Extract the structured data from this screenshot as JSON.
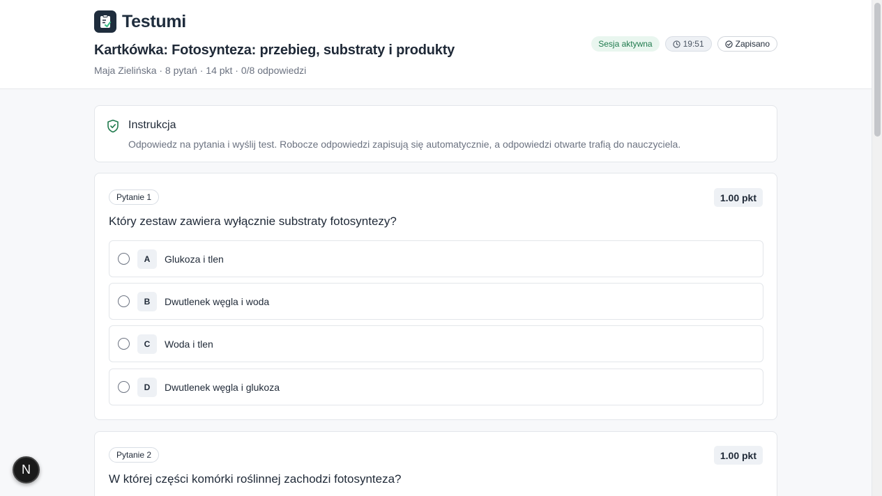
{
  "app": {
    "name": "Testumi"
  },
  "quiz": {
    "title": "Kartkówka: Fotosynteza: przebieg, substraty i produkty",
    "meta": "Maja Zielińska · 8 pytań · 14 pkt · 0/8 odpowiedzi"
  },
  "badges": {
    "session": "Sesja aktywna",
    "timer": "19:51",
    "saved": "Zapisano"
  },
  "instructions": {
    "title": "Instrukcja",
    "text": "Odpowiedz na pytania i wyślij test. Robocze odpowiedzi zapisują się automatycznie, a odpowiedzi otwarte trafią do nauczyciela."
  },
  "questions": [
    {
      "label": "Pytanie 1",
      "points": "1.00 pkt",
      "text": "Który zestaw zawiera wyłącznie substraty fotosyntezy?",
      "options": [
        {
          "letter": "A",
          "text": "Glukoza i tlen"
        },
        {
          "letter": "B",
          "text": "Dwutlenek węgla i woda"
        },
        {
          "letter": "C",
          "text": "Woda i tlen"
        },
        {
          "letter": "D",
          "text": "Dwutlenek węgla i glukoza"
        }
      ]
    },
    {
      "label": "Pytanie 2",
      "points": "1.00 pkt",
      "text": "W której części komórki roślinnej zachodzi fotosynteza?"
    }
  ],
  "fab": {
    "label": "N"
  },
  "icons": {
    "logo": "testumi-logo-icon",
    "clock": "clock-icon",
    "check": "check-circle-icon",
    "shield": "shield-check-icon"
  },
  "colors": {
    "brand": "#1f2d3d",
    "session_bg": "#e9f6ef",
    "session_text": "#1f7a4d",
    "shield": "#1f7a4d"
  }
}
